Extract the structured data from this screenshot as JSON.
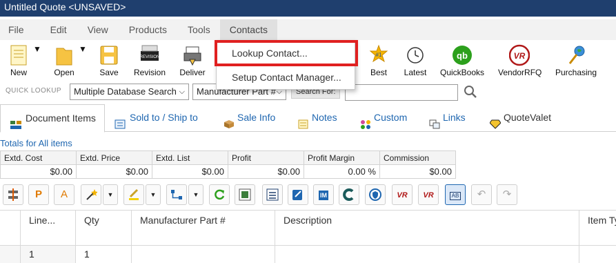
{
  "window": {
    "title": "Untitled Quote <UNSAVED>"
  },
  "menubar": {
    "items": [
      "File",
      "Edit",
      "View",
      "Products",
      "Tools",
      "Contacts"
    ]
  },
  "toolbar": {
    "new": "New",
    "open": "Open",
    "save": "Save",
    "revision": "Revision",
    "deliver": "Deliver",
    "best": "Best",
    "latest": "Latest",
    "quickbooks": "QuickBooks",
    "vendorrfq": "VendorRFQ",
    "purchasing": "Purchasing",
    "revision_icon_text": "REVISION",
    "best_badge": "#1",
    "qb_logo": "qb",
    "vr_logo": "VR"
  },
  "quick_lookup": {
    "label": "QUICK LOOKUP",
    "database_select": "Multiple Database Search",
    "field_select": "Manufacturer Part #",
    "search_label": "Search For:",
    "search_value": ""
  },
  "tabs": [
    "Document Items",
    "Sold to / Ship to",
    "Sale Info",
    "Notes",
    "Custom",
    "Links",
    "QuoteValet"
  ],
  "totals": {
    "title": "Totals for All items",
    "headers": [
      "Extd. Cost",
      "Extd. Price",
      "Extd. List",
      "Profit",
      "Profit Margin",
      "Commission"
    ],
    "values": [
      "$0.00",
      "$0.00",
      "$0.00",
      "$0.00",
      "0.00 %",
      "$0.00"
    ]
  },
  "grid_toolbar": {
    "p_label": "P",
    "a_label": "A",
    "im_label": "IM",
    "ab_label": "AB",
    "vr_label": "VR"
  },
  "grid": {
    "columns": [
      "Line...",
      "Qty",
      "Manufacturer Part #",
      "Description",
      "Item Ty"
    ],
    "rows": [
      {
        "line": "1",
        "qty": "1"
      }
    ]
  },
  "contacts_menu": {
    "items": [
      "Lookup Contact...",
      "Setup Contact Manager..."
    ]
  },
  "colors": {
    "titlebar": "#1f3f6e",
    "link": "#1e66b0",
    "highlight": "#e02020"
  }
}
